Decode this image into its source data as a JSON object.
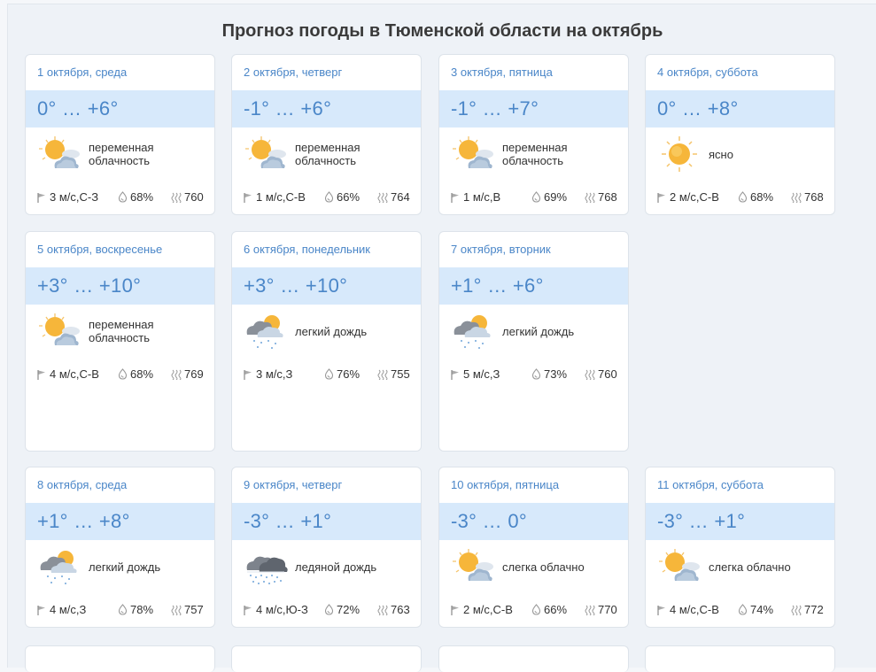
{
  "title": "Прогноз погоды в Тюменской области на октябрь",
  "days": [
    {
      "date": "1 октября, среда",
      "temp": "0° … +6°",
      "icon": "partly-cloudy-icon",
      "condition": "переменная облачность",
      "wind": "3 м/с,С-З",
      "humidity": "68%",
      "pressure": "760"
    },
    {
      "date": "2 октября, четверг",
      "temp": "-1° … +6°",
      "icon": "partly-cloudy-icon",
      "condition": "переменная облачность",
      "wind": "1 м/с,С-В",
      "humidity": "66%",
      "pressure": "764"
    },
    {
      "date": "3 октября, пятница",
      "temp": "-1° … +7°",
      "icon": "partly-cloudy-icon",
      "condition": "переменная облачность",
      "wind": "1 м/с,В",
      "humidity": "69%",
      "pressure": "768"
    },
    {
      "date": "4 октября, суббота",
      "temp": "0° … +8°",
      "icon": "sun-icon",
      "condition": "ясно",
      "wind": "2 м/с,С-В",
      "humidity": "68%",
      "pressure": "768"
    },
    {
      "date": "5 октября, воскресенье",
      "temp": "+3° … +10°",
      "icon": "partly-cloudy-icon",
      "condition": "переменная облачность",
      "wind": "4 м/с,С-В",
      "humidity": "68%",
      "pressure": "769"
    },
    {
      "date": "6 октября, понедельник",
      "temp": "+3° … +10°",
      "icon": "light-rain-icon",
      "condition": "легкий дождь",
      "wind": "3 м/с,З",
      "humidity": "76%",
      "pressure": "755"
    },
    {
      "date": "7 октября, вторник",
      "temp": "+1° … +6°",
      "icon": "light-rain-icon",
      "condition": "легкий дождь",
      "wind": "5 м/с,З",
      "humidity": "73%",
      "pressure": "760"
    },
    {
      "date": "8 октября, среда",
      "temp": "+1° … +8°",
      "icon": "light-rain-icon",
      "condition": "легкий дождь",
      "wind": "4 м/с,З",
      "humidity": "78%",
      "pressure": "757"
    },
    {
      "date": "9 октября, четверг",
      "temp": "-3° … +1°",
      "icon": "freezing-rain-icon",
      "condition": "ледяной дождь",
      "wind": "4 м/с,Ю-З",
      "humidity": "72%",
      "pressure": "763"
    },
    {
      "date": "10 октября, пятница",
      "temp": "-3° … 0°",
      "icon": "partly-cloudy-icon",
      "condition": "слегка облачно",
      "wind": "2 м/с,С-В",
      "humidity": "66%",
      "pressure": "770"
    },
    {
      "date": "11 октября, суббота",
      "temp": "-3° … +1°",
      "icon": "partly-cloudy-icon",
      "condition": "слегка облачно",
      "wind": "4 м/с,С-В",
      "humidity": "74%",
      "pressure": "772"
    }
  ]
}
